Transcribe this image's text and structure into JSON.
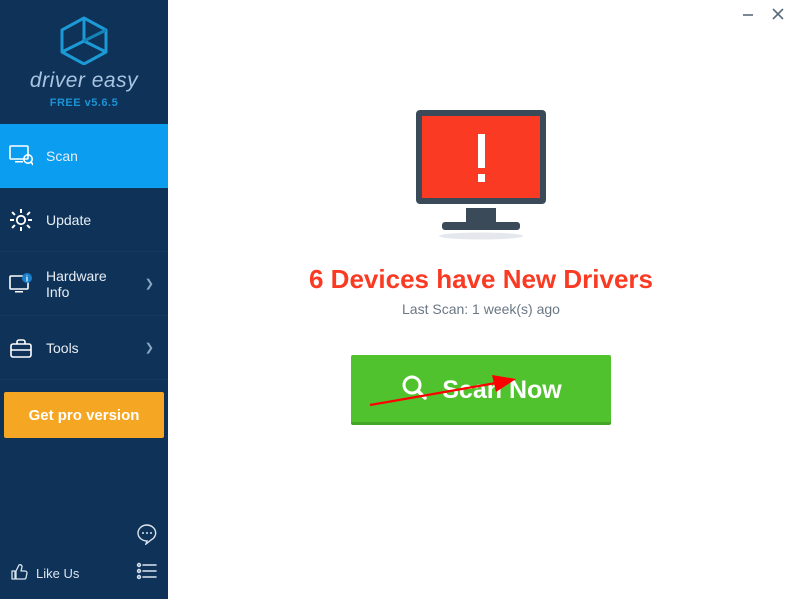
{
  "brand": {
    "name": "driver easy",
    "version_label": "FREE v5.6.5"
  },
  "sidebar": {
    "items": [
      {
        "label": "Scan",
        "active": true,
        "has_chevron": false
      },
      {
        "label": "Update",
        "active": false,
        "has_chevron": false
      },
      {
        "label": "Hardware Info",
        "active": false,
        "has_chevron": true
      },
      {
        "label": "Tools",
        "active": false,
        "has_chevron": true
      }
    ],
    "pro_button_label": "Get pro version",
    "like_label": "Like Us"
  },
  "main": {
    "headline": "6 Devices have New Drivers",
    "last_scan_label": "Last Scan: 1 week(s) ago",
    "scan_button_label": "Scan Now"
  },
  "status_color": "#fa3a22",
  "accent_color": "#0a9df0",
  "scan_btn_color": "#50c22e"
}
